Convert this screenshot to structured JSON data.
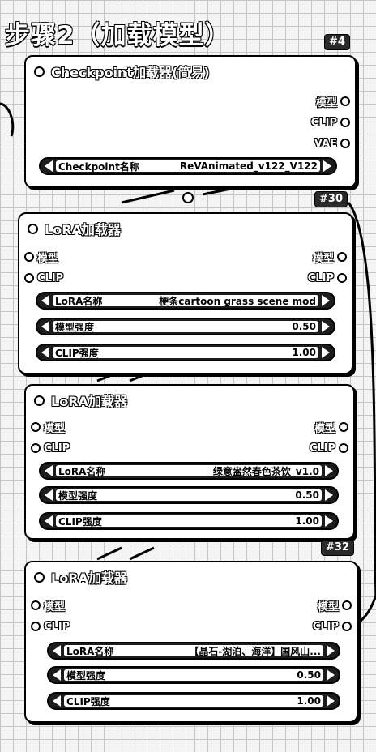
{
  "page_title": "步骤2（加载模型）",
  "badges": {
    "node4": "#4",
    "node30": "#30",
    "node32": "#32"
  },
  "checkpoint_node": {
    "title": "Checkpoint加载器(简易)",
    "outputs": [
      "模型",
      "CLIP",
      "VAE"
    ],
    "ckpt_name_label": "Checkpoint名称",
    "ckpt_name_value": "ReVAnimated_v122_V122"
  },
  "lora_nodes": [
    {
      "title": "LoRA加载器",
      "inputs": [
        "模型",
        "CLIP"
      ],
      "outputs": [
        "模型",
        "CLIP"
      ],
      "lora_name_label": "LoRA名称",
      "lora_name_value": "梗条cartoon grass scene mod",
      "model_strength_label": "模型强度",
      "model_strength_value": "0.50",
      "clip_strength_label": "CLIP强度",
      "clip_strength_value": "1.00"
    },
    {
      "title": "LoRA加载器",
      "inputs": [
        "模型",
        "CLIP"
      ],
      "outputs": [
        "模型",
        "CLIP"
      ],
      "lora_name_label": "LoRA名称",
      "lora_name_value": "绿意盎然春色茶饮_v1.0",
      "model_strength_label": "模型强度",
      "model_strength_value": "0.50",
      "clip_strength_label": "CLIP强度",
      "clip_strength_value": "1.00"
    },
    {
      "title": "LoRA加载器",
      "inputs": [
        "模型",
        "CLIP"
      ],
      "outputs": [
        "模型",
        "CLIP"
      ],
      "lora_name_label": "LoRA名称",
      "lora_name_value": "【晶石-湖泊、海洋】国风山...",
      "model_strength_label": "模型强度",
      "model_strength_value": "0.50",
      "clip_strength_label": "CLIP强度",
      "clip_strength_value": "1.00"
    }
  ]
}
